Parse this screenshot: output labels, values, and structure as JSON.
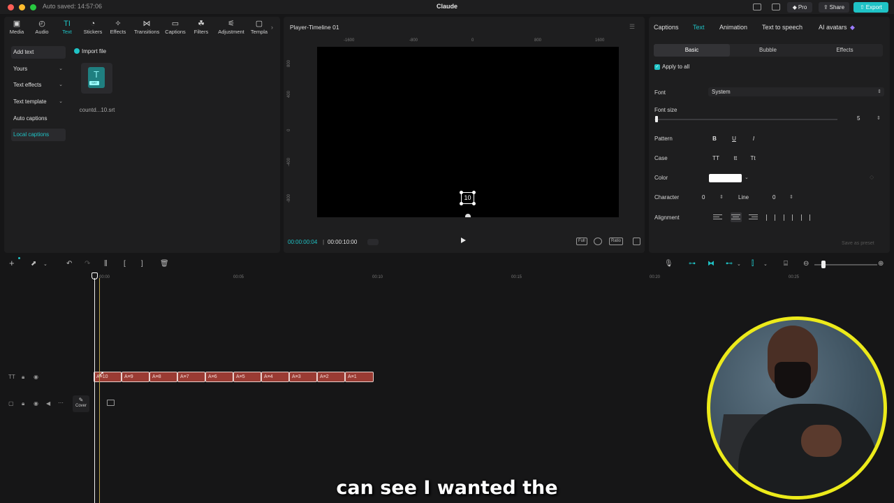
{
  "titlebar": {
    "autosaved": "Auto saved: 14:57:06",
    "app_title": "Claude",
    "pro": "Pro",
    "share": "Share",
    "export": "Export"
  },
  "media_tabs": [
    {
      "label": "Media",
      "icon": "media-icon"
    },
    {
      "label": "Audio",
      "icon": "audio-icon"
    },
    {
      "label": "Text",
      "icon": "text-icon"
    },
    {
      "label": "Stickers",
      "icon": "stickers-icon"
    },
    {
      "label": "Effects",
      "icon": "effects-icon"
    },
    {
      "label": "Transitions",
      "icon": "transitions-icon"
    },
    {
      "label": "Captions",
      "icon": "captions-icon"
    },
    {
      "label": "Filters",
      "icon": "filters-icon"
    },
    {
      "label": "Adjustment",
      "icon": "adjustment-icon"
    },
    {
      "label": "Templa",
      "icon": "templates-icon"
    }
  ],
  "left_sidebar": {
    "add_text": "Add text",
    "yours": "Yours",
    "text_effects": "Text effects",
    "text_template": "Text template",
    "auto_captions": "Auto captions",
    "local_captions": "Local captions"
  },
  "import": {
    "label": "Import file",
    "file_name": "countd...10.srt",
    "file_badge": "SRT",
    "file_glyph": "T"
  },
  "player": {
    "title": "Player-Timeline 01",
    "ruler_top": [
      "-1600",
      "-800",
      "0",
      "800",
      "1600"
    ],
    "ruler_left": [
      "800",
      "400",
      "0",
      "-400",
      "-800"
    ],
    "selected_text": "10",
    "time_current": "00:00:00:04",
    "time_separator": "|",
    "time_total": "00:00:10:00",
    "btn_full": "Full",
    "btn_ratio": "Ratio"
  },
  "right_panel": {
    "tabs": [
      "Captions",
      "Text",
      "Animation",
      "Text to speech",
      "AI avatars"
    ],
    "subtabs": [
      "Basic",
      "Bubble",
      "Effects"
    ],
    "apply_to_all": "Apply to all",
    "font_label": "Font",
    "font_value": "System",
    "font_size_label": "Font size",
    "font_size_value": "5",
    "pattern_label": "Pattern",
    "pattern_bold": "B",
    "pattern_underline": "U",
    "pattern_italic": "I",
    "case_label": "Case",
    "case_upper": "TT",
    "case_lower": "tt",
    "case_title": "Tt",
    "color_label": "Color",
    "color_value": "#ffffff",
    "character_label": "Character",
    "character_value": "0",
    "line_label": "Line",
    "line_value": "0",
    "alignment_label": "Alignment",
    "save_preset": "Save as preset"
  },
  "timeline": {
    "ruler": [
      "00:00",
      "00:05",
      "00:10",
      "00:15",
      "00:20",
      "00:25"
    ],
    "clips": [
      "10",
      "9",
      "8",
      "7",
      "6",
      "5",
      "4",
      "3",
      "2",
      "1"
    ],
    "clip_prefix": "A≡",
    "cover_label": "Cover"
  },
  "subtitle": "can see I wanted the",
  "colors": {
    "accent": "#1fc3c6",
    "clip": "#9a3b33",
    "webcam_ring": "#ecea1a"
  }
}
